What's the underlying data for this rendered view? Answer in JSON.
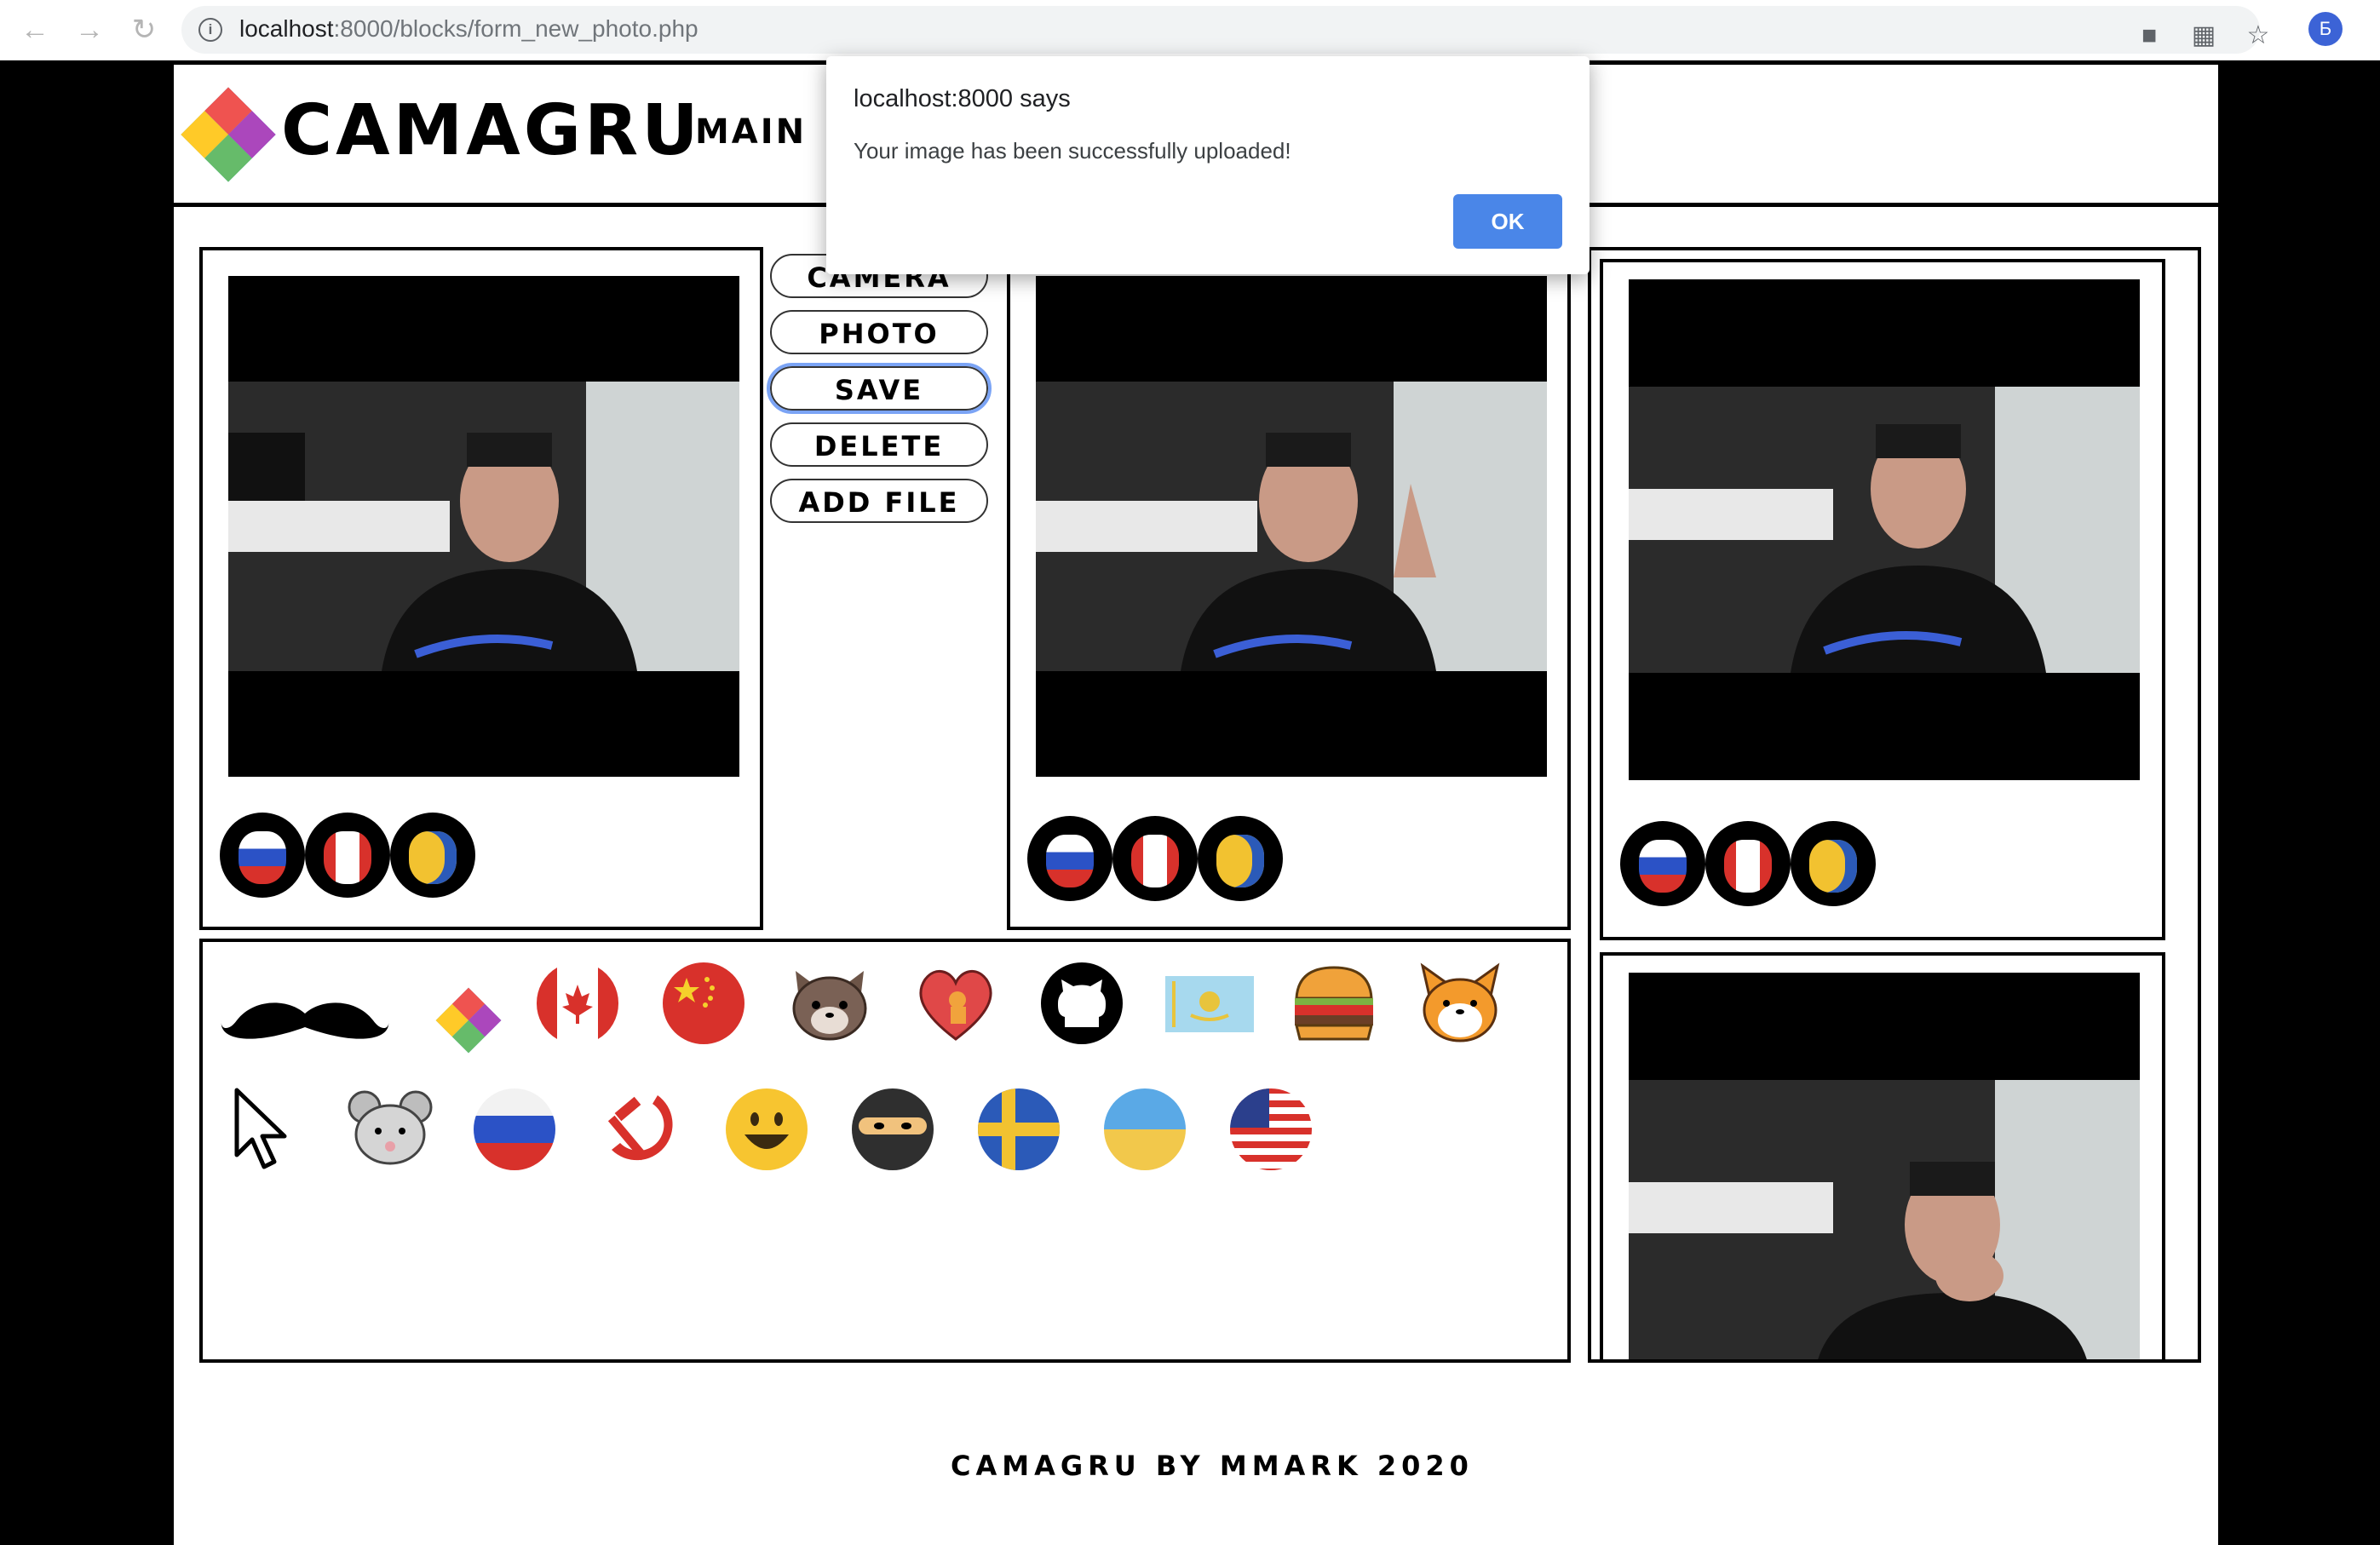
{
  "browser": {
    "url_host": "localhost",
    "url_rest": ":8000/blocks/form_new_photo.php",
    "avatar_letter": "Б",
    "icons": [
      "back-icon",
      "forward-icon",
      "reload-icon",
      "info-icon",
      "camera-icon",
      "translate-icon",
      "star-icon"
    ]
  },
  "header": {
    "brand": "CAMAGRU",
    "nav_main": "MAIN"
  },
  "buttons": {
    "camera": "CAMERA",
    "photo": "PHOTO",
    "save": "SAVE",
    "delete": "DELETE",
    "add_file": "ADD FILE"
  },
  "stickers": [
    "mustache",
    "camagru-logo",
    "canada-flag",
    "china-flag",
    "cat-face",
    "heart-dog",
    "github",
    "kazakhstan-flag",
    "burger",
    "corgi",
    "cursor",
    "mouse",
    "russia-flag",
    "hammer-sickle",
    "smiley",
    "ninja",
    "sweden-flag",
    "ukraine-flag",
    "usa-flag"
  ],
  "applied_stickers": [
    "russia-github",
    "canada-github",
    "sweden-github"
  ],
  "footer": "CAMAGRU BY MMARK 2020",
  "dialog": {
    "title": "localhost:8000 says",
    "message": "Your image has been successfully uploaded!",
    "ok": "OK"
  },
  "colors": {
    "accent_blue": "#4a86e8",
    "focus_ring": "#7ba4f5"
  }
}
